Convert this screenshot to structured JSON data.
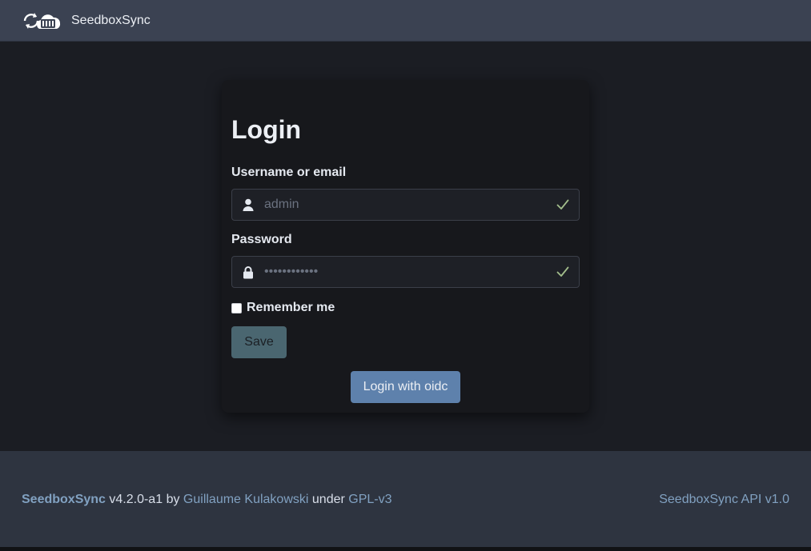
{
  "navbar": {
    "logo_icon": "cloud-sync-icon",
    "brand": "SeedboxSync"
  },
  "login": {
    "title": "Login",
    "username": {
      "label": "Username or email",
      "value": "",
      "placeholder": "admin",
      "icon": "user-icon",
      "status_icon": "check-icon"
    },
    "password": {
      "label": "Password",
      "value": "",
      "placeholder": "••••••••••••",
      "icon": "lock-icon",
      "status_icon": "check-icon"
    },
    "remember": {
      "label": "Remember me",
      "checked": false
    },
    "save_label": "Save",
    "oidc_label": "Login with oidc"
  },
  "footer": {
    "brand": "SeedboxSync",
    "version": "v4.2.0-a1",
    "by_text": "by",
    "author": "Guillaume Kulakowski",
    "under_text": "under",
    "license": "GPL-v3",
    "api_link": "SeedboxSync API v1.0"
  },
  "colors": {
    "navbar_bg": "#3b4252",
    "page_bg": "#1b1d23",
    "card_bg": "#17181c",
    "footer_bg": "#2e3440",
    "link": "#81a1c1",
    "primary_button": "#5e81ac",
    "save_button": "#4a6670",
    "valid_check": "#a3be8c"
  }
}
